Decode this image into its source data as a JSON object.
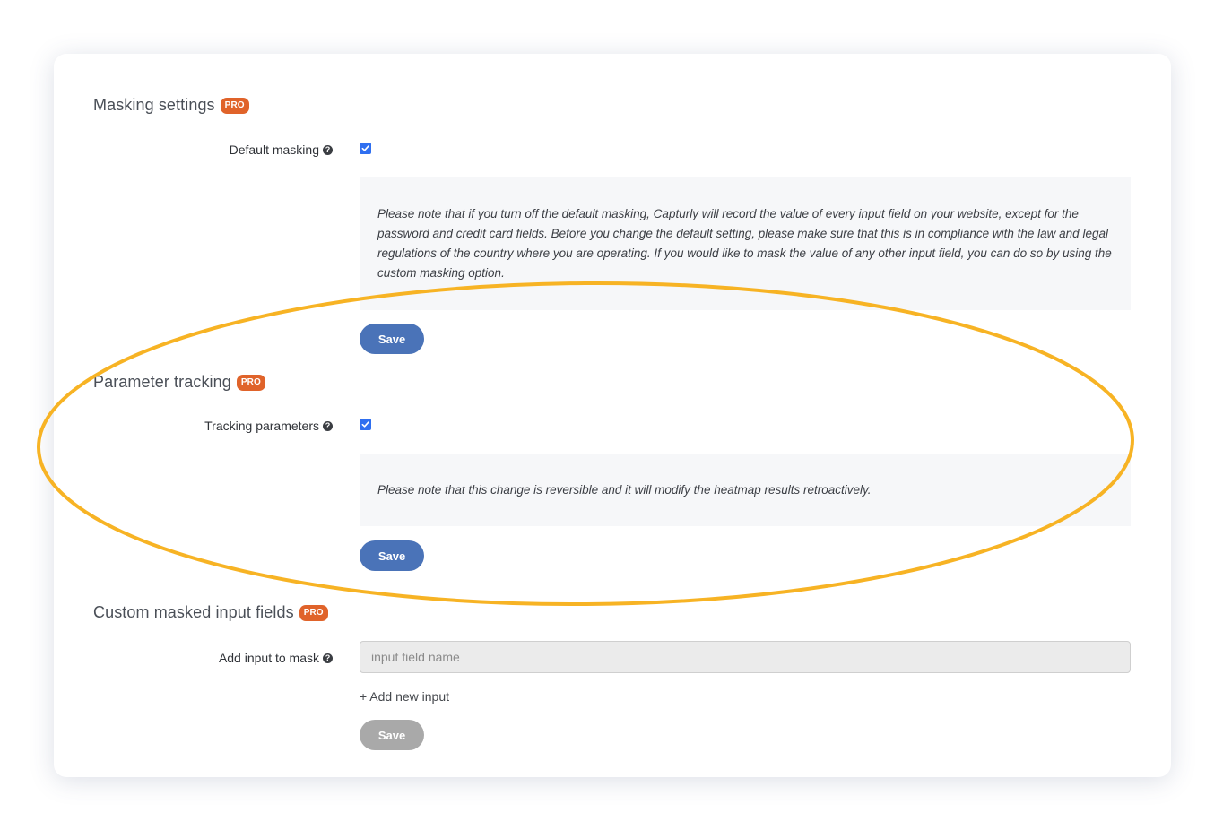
{
  "masking": {
    "title": "Masking settings",
    "badge": "PRO",
    "default_masking_label": "Default masking",
    "default_masking_checked": true,
    "note": "Please note that if you turn off the default masking, Capturly will record the value of every input field on your website, except for the password and credit card fields. Before you change the default setting, please make sure that this is in compliance with the law and legal regulations of the country where you are operating. If you would like to mask the value of any other input field, you can do so by using the custom masking option.",
    "save_label": "Save"
  },
  "parameter_tracking": {
    "title": "Parameter tracking",
    "badge": "PRO",
    "tracking_label": "Tracking parameters",
    "tracking_checked": true,
    "note": "Please note that this change is reversible and it will modify the heatmap results retroactively.",
    "save_label": "Save"
  },
  "custom_masked": {
    "title": "Custom masked input fields",
    "badge": "PRO",
    "add_input_label": "Add input to mask",
    "input_placeholder": "input field name",
    "input_value": "",
    "add_new_label": "+ Add new input",
    "save_label": "Save"
  },
  "icons": {
    "help": "question-circle-icon",
    "check": "checkmark-icon"
  },
  "colors": {
    "pro_badge": "#e0632a",
    "primary_button": "#4a73b8",
    "disabled_button": "#a9a9a9",
    "checkbox": "#2f6ff0",
    "highlight": "#f7b324"
  }
}
